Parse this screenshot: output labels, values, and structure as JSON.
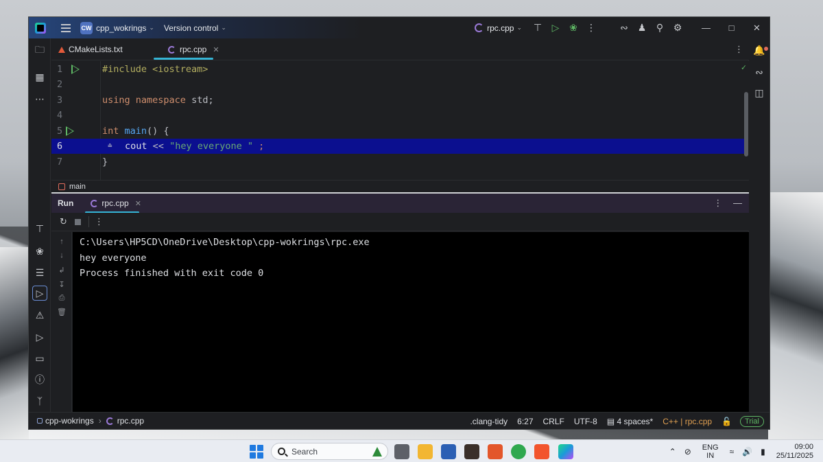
{
  "titlebar": {
    "project_badge": "CW",
    "project_name": "cpp_wokrings",
    "vcs": "Version control",
    "run_config": "rpc.cpp"
  },
  "tabs": [
    {
      "label": "CMakeLists.txt",
      "icon": "cmake-icon"
    },
    {
      "label": "rpc.cpp",
      "icon": "cpp-file-icon",
      "active": true
    }
  ],
  "editor": {
    "line_numbers": [
      "1",
      "2",
      "3",
      "4",
      "5",
      "6",
      "7"
    ],
    "highlighted_line": 6,
    "lines": {
      "l1_pre": "#include <iostream>",
      "l3_kw1": "using",
      "l3_kw2": "namespace",
      "l3_rest": "std;",
      "l5_kw": "int",
      "l5_fn": "main",
      "l5_rest": "() {",
      "l6_id": "cout",
      "l6_op": "<<",
      "l6_str": "\"hey everyone \"",
      "l6_semi": ";",
      "l7": "}"
    },
    "breadcrumb": "main"
  },
  "run_panel": {
    "title": "Run",
    "tab": "rpc.cpp",
    "output": [
      "C:\\Users\\HP5CD\\OneDrive\\Desktop\\cpp-wokrings\\rpc.exe",
      "hey everyone",
      "Process finished with exit code 0"
    ]
  },
  "statusbar": {
    "project": "cpp-wokrings",
    "file": "rpc.cpp",
    "linter": ".clang-tidy",
    "position": "6:27",
    "line_ending": "CRLF",
    "encoding": "UTF-8",
    "indent": "4 spaces*",
    "lang": "C++",
    "lang_file": "rpc.cpp",
    "trial": "Trial"
  },
  "taskbar": {
    "search_placeholder": "Search",
    "lang_line1": "ENG",
    "lang_line2": "IN",
    "time": "09:00",
    "date": "25/11/2025"
  },
  "colors": {
    "accent_underline": "#35b5d6",
    "line_highlight": "#0b0f8f",
    "run_green": "#5fb865"
  }
}
